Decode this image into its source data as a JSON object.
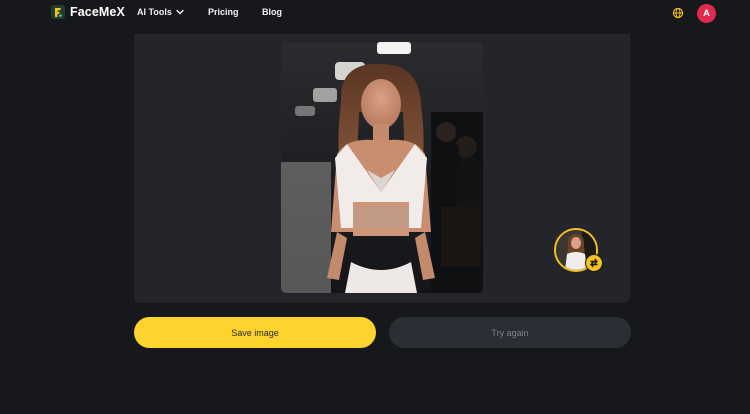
{
  "app": {
    "name": "FaceMeX"
  },
  "nav": {
    "ai_tools": "AI Tools",
    "pricing": "Pricing",
    "blog": "Blog"
  },
  "user": {
    "avatar_letter": "A"
  },
  "icons": {
    "logo": "facemex-logo-icon",
    "dropdown": "chevron-down-icon",
    "language": "globe-icon",
    "swap": "swap-arrows-icon"
  },
  "colors": {
    "accent": "#fcd42d",
    "avatar": "#e0294f",
    "background": "#17181b",
    "panel": "#23252a"
  },
  "actions": {
    "save": "Save image",
    "retry": "Try again"
  }
}
